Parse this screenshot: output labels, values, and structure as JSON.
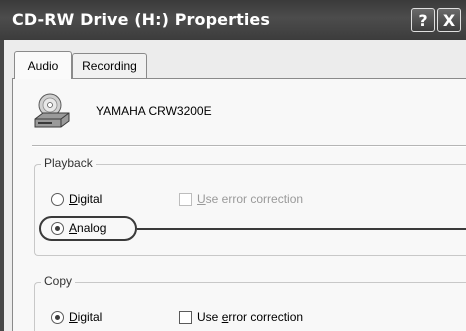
{
  "window": {
    "title": "CD-RW Drive (H:) Properties",
    "help_label": "?",
    "close_label": "X"
  },
  "tabs": [
    {
      "label": "Audio",
      "selected": true
    },
    {
      "label": "Recording",
      "selected": false
    }
  ],
  "drive": {
    "icon": "cd-drive-icon",
    "name": "YAMAHA  CRW3200E"
  },
  "playback": {
    "legend": "Playback",
    "digital": {
      "pre": "",
      "key": "D",
      "post": "igital",
      "selected": false
    },
    "analog": {
      "pre": "",
      "key": "A",
      "post": "nalog",
      "selected": true
    },
    "error_correction": {
      "pre": "",
      "key": "U",
      "post": "se error correction",
      "enabled": false,
      "checked": false
    }
  },
  "copy": {
    "legend": "Copy",
    "digital": {
      "pre": "",
      "key": "D",
      "post": "igital",
      "selected": true
    },
    "error_correction": {
      "pre": "Use ",
      "key": "e",
      "post": "rror correction",
      "enabled": true,
      "checked": false
    }
  },
  "colors": {
    "titlebar": "#3c3c3c",
    "dialog_bg": "#f8f8f8",
    "callout": "#3a3a3a"
  }
}
